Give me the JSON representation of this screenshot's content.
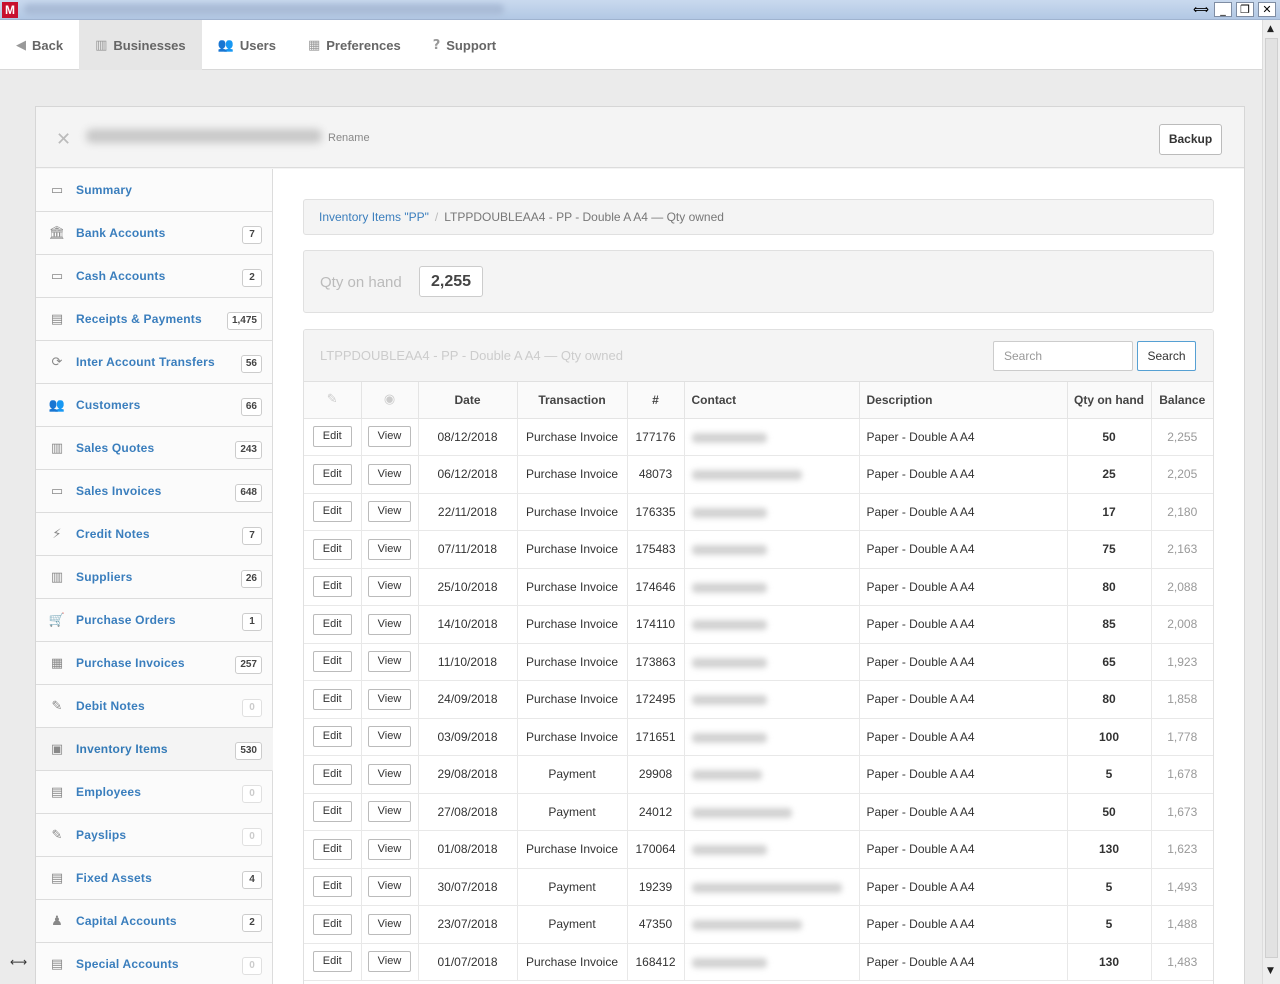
{
  "window": {
    "app_icon": "M",
    "controls": [
      "⟺",
      "_",
      "❐",
      "✕"
    ]
  },
  "nav": {
    "items": [
      {
        "label": "Back",
        "icon": "◀"
      },
      {
        "label": "Businesses",
        "icon": "▥"
      },
      {
        "label": "Users",
        "icon": "👥"
      },
      {
        "label": "Preferences",
        "icon": "▦"
      },
      {
        "label": "Support",
        "icon": "?"
      }
    ]
  },
  "panel": {
    "close": "✕",
    "rename": "Rename",
    "backup": "Backup"
  },
  "sidebar": {
    "items": [
      {
        "label": "Summary",
        "badge": "",
        "icon": "▭"
      },
      {
        "label": "Bank Accounts",
        "badge": "7",
        "icon": "🏛"
      },
      {
        "label": "Cash Accounts",
        "badge": "2",
        "icon": "▭"
      },
      {
        "label": "Receipts & Payments",
        "badge": "1,475",
        "icon": "▤"
      },
      {
        "label": "Inter Account Transfers",
        "badge": "56",
        "icon": "⟳"
      },
      {
        "label": "Customers",
        "badge": "66",
        "icon": "👥"
      },
      {
        "label": "Sales Quotes",
        "badge": "243",
        "icon": "▥"
      },
      {
        "label": "Sales Invoices",
        "badge": "648",
        "icon": "▭"
      },
      {
        "label": "Credit Notes",
        "badge": "7",
        "icon": "⚡"
      },
      {
        "label": "Suppliers",
        "badge": "26",
        "icon": "▥"
      },
      {
        "label": "Purchase Orders",
        "badge": "1",
        "icon": "🛒"
      },
      {
        "label": "Purchase Invoices",
        "badge": "257",
        "icon": "▦"
      },
      {
        "label": "Debit Notes",
        "badge": "0",
        "icon": "✎"
      },
      {
        "label": "Inventory Items",
        "badge": "530",
        "icon": "▣"
      },
      {
        "label": "Employees",
        "badge": "0",
        "icon": "▤"
      },
      {
        "label": "Payslips",
        "badge": "0",
        "icon": "✎"
      },
      {
        "label": "Fixed Assets",
        "badge": "4",
        "icon": "▤"
      },
      {
        "label": "Capital Accounts",
        "badge": "2",
        "icon": "♟"
      },
      {
        "label": "Special Accounts",
        "badge": "0",
        "icon": "▤"
      }
    ]
  },
  "breadcrumb": {
    "link": "Inventory Items \"PP\"",
    "separator": "/",
    "current": "LTPPDOUBLEAA4 - PP - Double A A4 — Qty owned"
  },
  "qty_on_hand": {
    "label": "Qty on hand",
    "value": "2,255"
  },
  "table": {
    "title": "LTPPDOUBLEAA4 - PP - Double A A4 — Qty owned",
    "search_placeholder": "Search",
    "search_button": "Search",
    "edit_icon": "✎",
    "view_icon": "◉",
    "headers": [
      "Date",
      "Transaction",
      "#",
      "Contact",
      "Description",
      "Qty on hand",
      "Balance"
    ],
    "edit_label": "Edit",
    "view_label": "View",
    "rows": [
      {
        "date": "08/12/2018",
        "transaction": "Purchase Invoice",
        "number": "177176",
        "description": "Paper - Double A A4",
        "qty": "50",
        "balance": "2,255"
      },
      {
        "date": "06/12/2018",
        "transaction": "Purchase Invoice",
        "number": "48073",
        "description": "Paper - Double A A4",
        "qty": "25",
        "balance": "2,205"
      },
      {
        "date": "22/11/2018",
        "transaction": "Purchase Invoice",
        "number": "176335",
        "description": "Paper - Double A A4",
        "qty": "17",
        "balance": "2,180"
      },
      {
        "date": "07/11/2018",
        "transaction": "Purchase Invoice",
        "number": "175483",
        "description": "Paper - Double A A4",
        "qty": "75",
        "balance": "2,163"
      },
      {
        "date": "25/10/2018",
        "transaction": "Purchase Invoice",
        "number": "174646",
        "description": "Paper - Double A A4",
        "qty": "80",
        "balance": "2,088"
      },
      {
        "date": "14/10/2018",
        "transaction": "Purchase Invoice",
        "number": "174110",
        "description": "Paper - Double A A4",
        "qty": "85",
        "balance": "2,008"
      },
      {
        "date": "11/10/2018",
        "transaction": "Purchase Invoice",
        "number": "173863",
        "description": "Paper - Double A A4",
        "qty": "65",
        "balance": "1,923"
      },
      {
        "date": "24/09/2018",
        "transaction": "Purchase Invoice",
        "number": "172495",
        "description": "Paper - Double A A4",
        "qty": "80",
        "balance": "1,858"
      },
      {
        "date": "03/09/2018",
        "transaction": "Purchase Invoice",
        "number": "171651",
        "description": "Paper - Double A A4",
        "qty": "100",
        "balance": "1,778"
      },
      {
        "date": "29/08/2018",
        "transaction": "Payment",
        "number": "29908",
        "description": "Paper - Double A A4",
        "qty": "5",
        "balance": "1,678"
      },
      {
        "date": "27/08/2018",
        "transaction": "Payment",
        "number": "24012",
        "description": "Paper - Double A A4",
        "qty": "50",
        "balance": "1,673"
      },
      {
        "date": "01/08/2018",
        "transaction": "Purchase Invoice",
        "number": "170064",
        "description": "Paper - Double A A4",
        "qty": "130",
        "balance": "1,623"
      },
      {
        "date": "30/07/2018",
        "transaction": "Payment",
        "number": "19239",
        "description": "Paper - Double A A4",
        "qty": "5",
        "balance": "1,493"
      },
      {
        "date": "23/07/2018",
        "transaction": "Payment",
        "number": "47350",
        "description": "Paper - Double A A4",
        "qty": "5",
        "balance": "1,488"
      },
      {
        "date": "01/07/2018",
        "transaction": "Purchase Invoice",
        "number": "168412",
        "description": "Paper - Double A A4",
        "qty": "130",
        "balance": "1,483"
      }
    ]
  }
}
